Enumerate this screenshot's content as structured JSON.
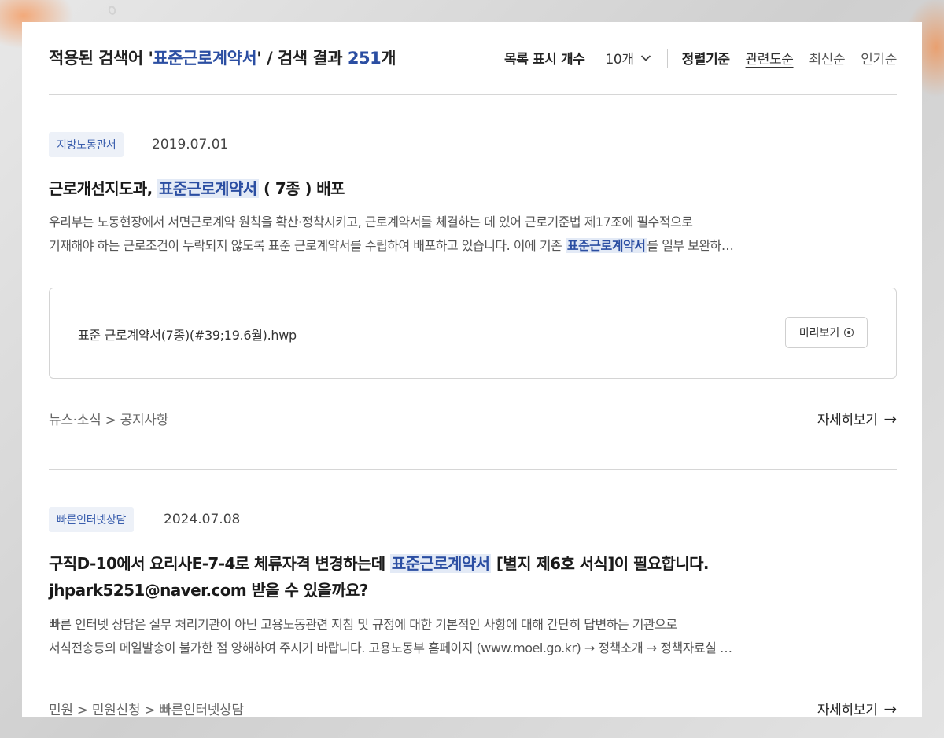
{
  "header": {
    "prefix": "적용된 검색어 '",
    "query": "표준근로계약서",
    "middle": "' / 검색 결과 ",
    "count": "251",
    "suffix": "개",
    "per_page_label": "목록 표시 개수",
    "per_page_value": "10개",
    "sort_label": "정렬기준",
    "sort_options": [
      "관련도순",
      "최신순",
      "인기순"
    ],
    "sort_active": "관련도순"
  },
  "results": [
    {
      "tag": "지방노동관서",
      "date": "2019.07.01",
      "title_pre": "근로개선지도과, ",
      "title_mark": "표준근로계약서",
      "title_post": " ( 7종 ) 배포",
      "desc_line1": "우리부는 노동현장에서 서면근로계약 원칙을 확산·정착시키고, 근로계약서를 체결하는 데 있어 근로기준법 제17조에 필수적으로",
      "desc_line2_pre": "기재해야 하는 근로조건이 누락되지 않도록 표준 근로계약서를 수립하여 배포하고 있습니다. 이에 기존 ",
      "desc_line2_mark": "표준근로계약서",
      "desc_line2_post": "를 일부 보완하…",
      "file_name": "표준 근로계약서(7종)(#39;19.6월).hwp",
      "preview_label": "미리보기",
      "breadcrumb": "뉴스·소식 > 공지사항",
      "more_label": "자세히보기"
    },
    {
      "tag": "빠른인터넷상담",
      "date": "2024.07.08",
      "title_pre": "구직D-10에서 요리사E-7-4로 체류자격 변경하는데 ",
      "title_mark": "표준근로계약서",
      "title_post": " [별지 제6호 서식]이 필요합니다.",
      "title_line2": "jhpark5251@naver.com 받을 수 있을까요?",
      "desc_line1": "빠른 인터넷 상담은 실무 처리기관이 아닌 고용노동관련 지침 및 규정에 대한 기본적인 사항에 대해 간단히 답변하는 기관으로",
      "desc_line2": "서식전송등의 메일발송이 불가한 점 양해하여 주시기 바랍니다. 고용노동부 홈페이지 (www.moel.go.kr) → 정책소개 → 정책자료실 …",
      "breadcrumb": "민원 > 민원신청 > 빠른인터넷상담",
      "more_label": "자세히보기"
    }
  ],
  "icons": {
    "chevron": "chevron-down-icon",
    "eye": "eye-icon",
    "arrow": "arrow-right-icon"
  },
  "colors": {
    "accent": "#2b4ea2",
    "highlight_bg": "#e3eaf6",
    "tag_bg": "#edf1f8"
  }
}
